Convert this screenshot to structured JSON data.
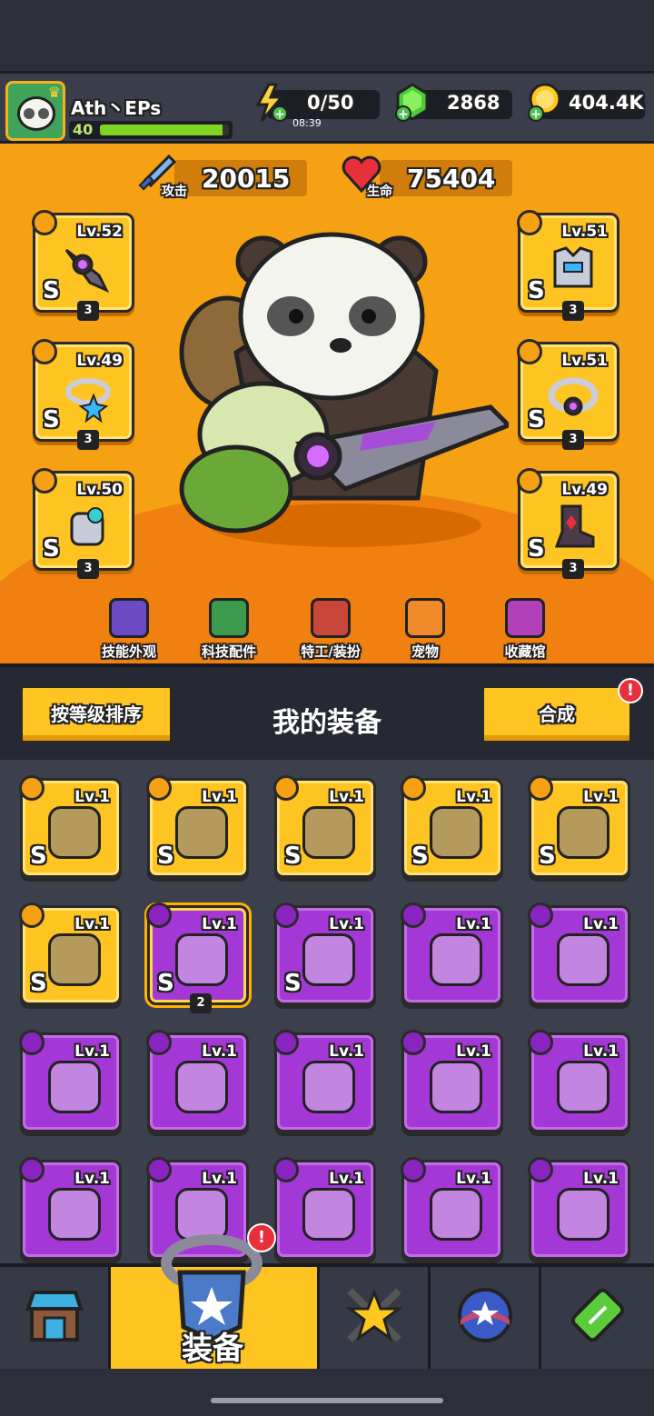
{
  "player": {
    "name": "Ath丶EPs",
    "level": "40",
    "xp_fraction": 0.95
  },
  "resources": {
    "energy": {
      "value": "0/50",
      "timer": "08:39",
      "icon": "lightning-icon"
    },
    "gems": {
      "value": "2868",
      "icon": "gem-icon"
    },
    "coins": {
      "value": "404.4K",
      "icon": "coin-icon"
    }
  },
  "stats": {
    "attack": {
      "label": "攻击",
      "value": "20015",
      "icon": "sword-icon"
    },
    "hp": {
      "label": "生命",
      "value": "75404",
      "icon": "heart-icon"
    }
  },
  "equipped": {
    "left": [
      {
        "type": "weapon",
        "lv": "Lv.52",
        "rank": "S",
        "stars": "3"
      },
      {
        "type": "necklace",
        "lv": "Lv.49",
        "rank": "S",
        "stars": "3"
      },
      {
        "type": "glove",
        "lv": "Lv.50",
        "rank": "S",
        "stars": "3"
      }
    ],
    "right": [
      {
        "type": "armor",
        "lv": "Lv.51",
        "rank": "S",
        "stars": "3"
      },
      {
        "type": "belt",
        "lv": "Lv.51",
        "rank": "S",
        "stars": "3"
      },
      {
        "type": "boots",
        "lv": "Lv.49",
        "rank": "S",
        "stars": "3"
      }
    ]
  },
  "categories": [
    {
      "label": "技能外观",
      "icon": "soccer-hat-icon",
      "color": "#6a4bc4"
    },
    {
      "label": "科技配件",
      "icon": "tech-hex-icon",
      "color": "#3c9a4c"
    },
    {
      "label": "特工/装扮",
      "icon": "agent-icon",
      "color": "#c8463a"
    },
    {
      "label": "宠物",
      "icon": "dog-icon",
      "color": "#f08a2a"
    },
    {
      "label": "收藏馆",
      "icon": "collection-chest-icon",
      "color": "#b03fb8"
    }
  ],
  "inventory": {
    "sort_label": "按等级排序",
    "title": "我的装备",
    "merge_label": "合成",
    "merge_alert": "!",
    "items": [
      {
        "lv": "Lv.1",
        "rarity": "gold",
        "rank": "S",
        "art": "shuriken-blade-icon"
      },
      {
        "lv": "Lv.1",
        "rarity": "gold",
        "rank": "S",
        "art": "armor-vest-icon"
      },
      {
        "lv": "Lv.1",
        "rarity": "gold",
        "rank": "S",
        "art": "star-necklace-icon"
      },
      {
        "lv": "Lv.1",
        "rarity": "gold",
        "rank": "S",
        "art": "gold-belt-icon"
      },
      {
        "lv": "Lv.1",
        "rarity": "gold",
        "rank": "S",
        "art": "mech-glove-icon"
      },
      {
        "lv": "Lv.1",
        "rarity": "gold",
        "rank": "S",
        "art": "mech-boots-icon"
      },
      {
        "lv": "Lv.1",
        "rarity": "purple",
        "rank": "S",
        "art": "orb-belt-icon",
        "stars": "2",
        "selected": true
      },
      {
        "lv": "Lv.1",
        "rarity": "purple",
        "rank": "S",
        "art": "gem-belt-icon"
      },
      {
        "lv": "Lv.1",
        "rarity": "purple",
        "rank": "",
        "art": "kunai-icon"
      },
      {
        "lv": "Lv.1",
        "rarity": "purple",
        "rank": "",
        "art": "torch-icon"
      },
      {
        "lv": "Lv.1",
        "rarity": "purple",
        "rank": "",
        "art": "green-vest-icon"
      },
      {
        "lv": "Lv.1",
        "rarity": "purple",
        "rank": "",
        "art": "green-ring-icon"
      },
      {
        "lv": "Lv.1",
        "rarity": "purple",
        "rank": "",
        "art": "chain-necklace-icon"
      },
      {
        "lv": "Lv.1",
        "rarity": "purple",
        "rank": "",
        "art": "badge-necklace-icon"
      },
      {
        "lv": "Lv.1",
        "rarity": "purple",
        "rank": "",
        "art": "badge-necklace-icon"
      },
      {
        "lv": "Lv.1",
        "rarity": "purple",
        "rank": "",
        "art": "rope-belt-icon"
      },
      {
        "lv": "Lv.1",
        "rarity": "purple",
        "rank": "",
        "art": "tech-belt-icon"
      },
      {
        "lv": "Lv.1",
        "rarity": "purple",
        "rank": "",
        "art": "claw-glove-icon"
      },
      {
        "lv": "Lv.1",
        "rarity": "purple",
        "rank": "",
        "art": "steel-glove-icon"
      },
      {
        "lv": "Lv.1",
        "rarity": "purple",
        "rank": "",
        "art": "gem-glove-icon"
      }
    ]
  },
  "nav": {
    "active_label": "装备",
    "alert": "!",
    "tabs": [
      {
        "name": "shop",
        "icon": "shop-icon"
      },
      {
        "name": "equipment",
        "icon": "equipment-badge-icon"
      },
      {
        "name": "skills",
        "icon": "crossed-swords-star-icon"
      },
      {
        "name": "events",
        "icon": "star-ball-icon"
      },
      {
        "name": "research",
        "icon": "dna-battery-icon"
      }
    ]
  },
  "colors": {
    "gold": "#fdc422",
    "purple": "#a438d6",
    "orange": "#f6a013",
    "alert": "#e8303c"
  }
}
